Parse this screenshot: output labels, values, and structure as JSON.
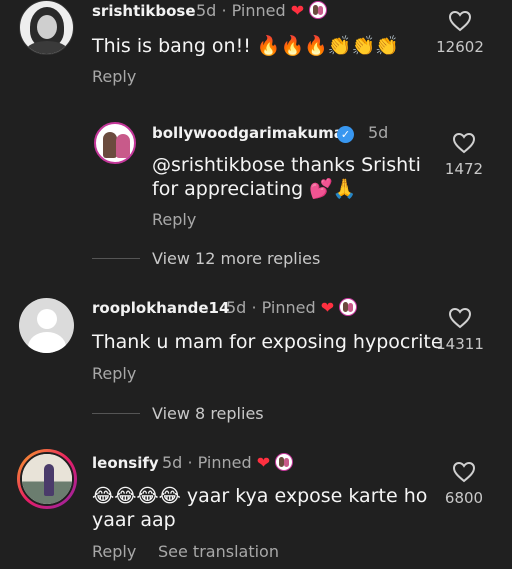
{
  "comments": [
    {
      "username": "srishtikbose",
      "age": "5d",
      "pinned": "Pinned",
      "text": "This is bang on!! 🔥🔥🔥👏👏👏",
      "likes": "12602",
      "reply_label": "Reply"
    },
    {
      "username": "bollywoodgarimakumar",
      "age": "5d",
      "text_line1": "@srishtikbose thanks Srishti",
      "text_line2": "for appreciating 💕🙏",
      "likes": "1472",
      "reply_label": "Reply",
      "view_replies": "View 12 more replies"
    },
    {
      "username": "rooplokhande14",
      "age": "5d",
      "pinned": "Pinned",
      "text": "Thank u mam for exposing hypocrite",
      "likes": "14311",
      "reply_label": "Reply",
      "view_replies": "View 8 replies"
    },
    {
      "username": "leonsify",
      "age": "5d",
      "pinned": "Pinned",
      "text_line1": "😂😂😂😂 yaar kya expose karte ho",
      "text_line2": "yaar aap",
      "likes": "6800",
      "reply_label": "Reply",
      "translation_label": "See translation"
    }
  ],
  "separator": "·",
  "verified_glyph": "✓",
  "heart_glyph": "❤",
  "colors": {
    "background": "#202020",
    "secondary_text": "#a8a8a8",
    "heart": "#ff3040",
    "verified": "#3897f0"
  }
}
